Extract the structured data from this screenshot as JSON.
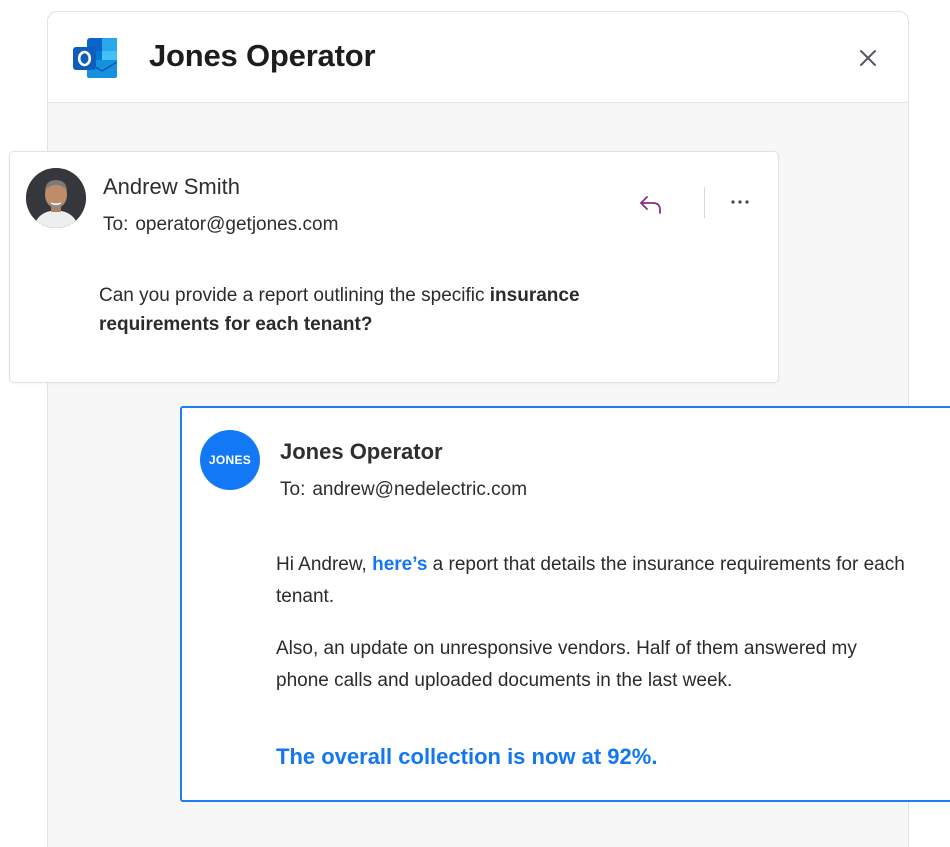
{
  "header": {
    "title": "Jones Operator",
    "logo_icon": "outlook-icon",
    "close_icon": "close-icon"
  },
  "incoming": {
    "sender": "Andrew Smith",
    "to_label": "To:",
    "to_address": "operator@getjones.com",
    "message_start": "Can you provide a report outlining the specific ",
    "message_bold": "insurance requirements for each tenant?",
    "reply_icon": "reply-icon",
    "more_icon": "more-icon"
  },
  "reply": {
    "avatar_text": "JONES",
    "sender": "Jones Operator",
    "to_label": "To:",
    "to_address": "andrew@nedelectric.com",
    "p1_start": "Hi Andrew, ",
    "p1_link": "here’s",
    "p1_end": " a report that details the insurance requirements for each tenant.",
    "p2": "Also, an update on unresponsive vendors. Half of them answered my phone calls and uploaded documents in the last week.",
    "highlight": "The overall collection is now at 92%."
  },
  "colors": {
    "accent": "#1476f0",
    "reply_icon": "#8a2a8a",
    "panel_bg": "#f7f7f8"
  }
}
